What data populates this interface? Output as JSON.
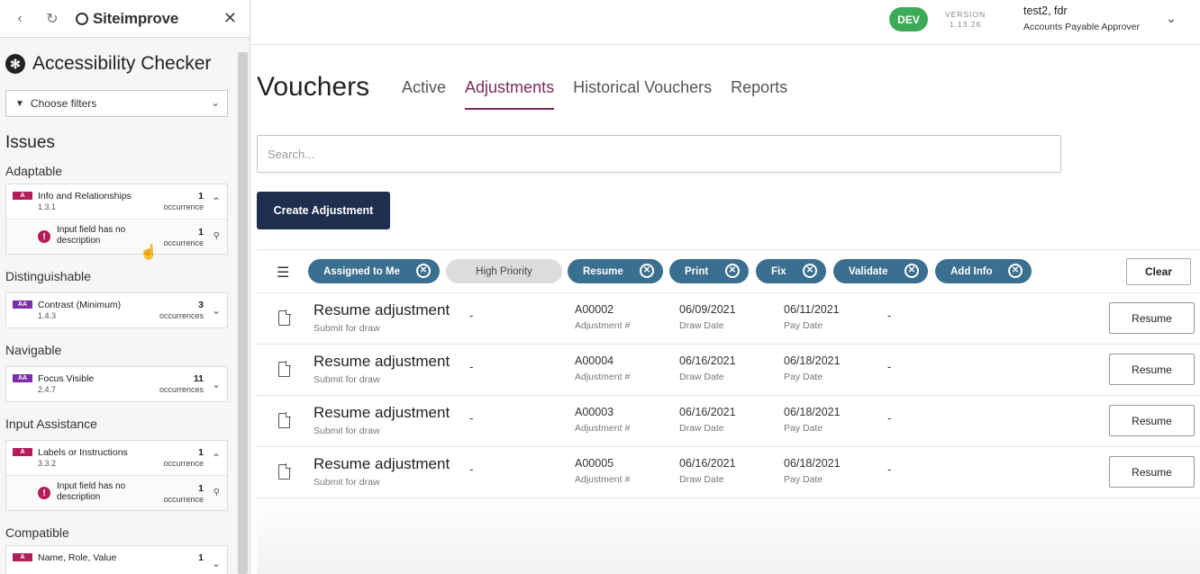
{
  "sidebar": {
    "brand": "Siteimprove",
    "title": "Accessibility Checker",
    "filter_label": "Choose filters",
    "issues_heading": "Issues",
    "categories": [
      {
        "name": "Adaptable",
        "items": [
          {
            "level": "A",
            "name": "Info and Relationships",
            "code": "1.3.1",
            "count": "1",
            "count_label": "occurrence",
            "expanded": true,
            "sub": {
              "name": "Input field has no description",
              "count": "1",
              "count_label": "occurrence"
            }
          }
        ]
      },
      {
        "name": "Distinguishable",
        "items": [
          {
            "level": "AA",
            "name": "Contrast (Minimum)",
            "code": "1.4.3",
            "count": "3",
            "count_label": "occurrences"
          }
        ]
      },
      {
        "name": "Navigable",
        "items": [
          {
            "level": "AA",
            "name": "Focus Visible",
            "code": "2.4.7",
            "count": "11",
            "count_label": "occurrences"
          }
        ]
      },
      {
        "name": "Input Assistance",
        "items": [
          {
            "level": "A",
            "name": "Labels or Instructions",
            "code": "3.3.2",
            "count": "1",
            "count_label": "occurrence",
            "expanded": true,
            "sub": {
              "name": "Input field has no description",
              "count": "1",
              "count_label": "occurrence"
            }
          }
        ]
      },
      {
        "name": "Compatible",
        "items": [
          {
            "level": "A",
            "name": "Name, Role, Value",
            "code": "",
            "count": "1",
            "count_label": ""
          }
        ]
      }
    ]
  },
  "header": {
    "env_badge": "DEV",
    "version_label": "VERSION",
    "version": "1.13.26",
    "user_name": "test2, fdr",
    "user_role": "Accounts Payable Approver"
  },
  "page": {
    "title": "Vouchers",
    "tabs": [
      "Active",
      "Adjustments",
      "Historical Vouchers",
      "Reports"
    ],
    "active_tab": "Adjustments",
    "search_placeholder": "Search...",
    "create_button": "Create Adjustment",
    "clear_button": "Clear"
  },
  "chips": [
    {
      "label": "Assigned to Me",
      "active": true
    },
    {
      "label": "High Priority",
      "active": false
    },
    {
      "label": "Resume",
      "active": true
    },
    {
      "label": "Print",
      "active": true
    },
    {
      "label": "Fix",
      "active": true
    },
    {
      "label": "Validate",
      "active": true
    },
    {
      "label": "Add Info",
      "active": true
    }
  ],
  "rows": [
    {
      "title": "Resume adjustment",
      "subtitle": "Submit for draw",
      "dash1": "-",
      "adjustment": "A00002",
      "adjustment_label": "Adjustment #",
      "draw_date": "06/09/2021",
      "draw_label": "Draw Date",
      "pay_date": "06/11/2021",
      "pay_label": "Pay Date",
      "dash2": "-",
      "action": "Resume"
    },
    {
      "title": "Resume adjustment",
      "subtitle": "Submit for draw",
      "dash1": "-",
      "adjustment": "A00004",
      "adjustment_label": "Adjustment #",
      "draw_date": "06/16/2021",
      "draw_label": "Draw Date",
      "pay_date": "06/18/2021",
      "pay_label": "Pay Date",
      "dash2": "-",
      "action": "Resume"
    },
    {
      "title": "Resume adjustment",
      "subtitle": "Submit for draw",
      "dash1": "-",
      "adjustment": "A00003",
      "adjustment_label": "Adjustment #",
      "draw_date": "06/16/2021",
      "draw_label": "Draw Date",
      "pay_date": "06/18/2021",
      "pay_label": "Pay Date",
      "dash2": "-",
      "action": "Resume"
    },
    {
      "title": "Resume adjustment",
      "subtitle": "Submit for draw",
      "dash1": "-",
      "adjustment": "A00005",
      "adjustment_label": "Adjustment #",
      "draw_date": "06/16/2021",
      "draw_label": "Draw Date",
      "pay_date": "06/18/2021",
      "pay_label": "Pay Date",
      "dash2": "-",
      "action": "Resume"
    }
  ],
  "colors": {
    "accent": "#7b2b64",
    "chip": "#3b6f8f",
    "primary_button": "#1d2e4f",
    "dev_badge": "#3daa58"
  }
}
